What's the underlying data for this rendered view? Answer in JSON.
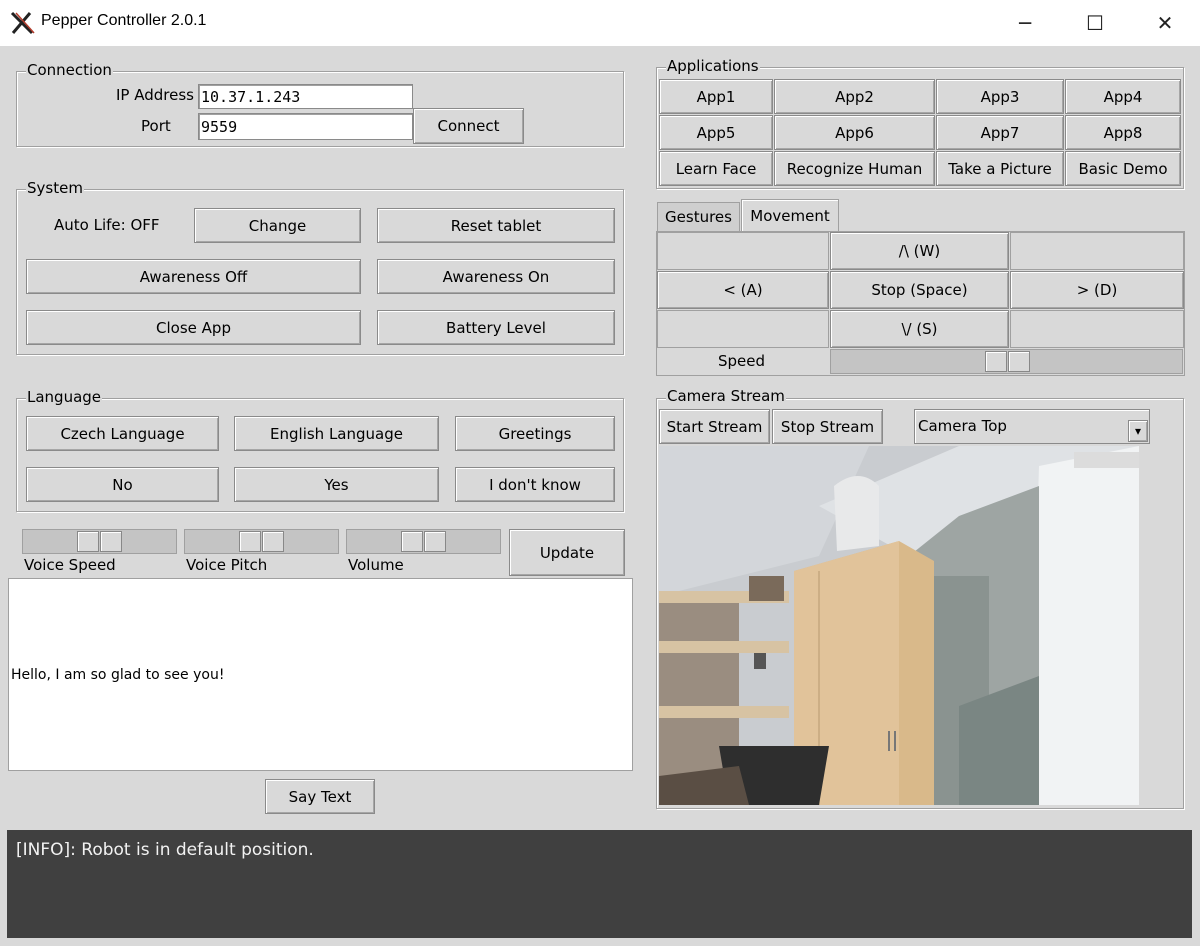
{
  "window": {
    "title": "Pepper Controller 2.0.1",
    "minimize": "─",
    "maximize": "☐",
    "close": "✕"
  },
  "connection": {
    "legend": "Connection",
    "ip_label": "IP Address",
    "ip_value": "10.37.1.243",
    "port_label": "Port",
    "port_value": "9559",
    "connect": "Connect"
  },
  "system": {
    "legend": "System",
    "auto_life": "Auto Life: OFF",
    "change": "Change",
    "reset_tablet": "Reset tablet",
    "awareness_off": "Awareness Off",
    "awareness_on": "Awareness On",
    "close_app": "Close App",
    "battery_level": "Battery Level"
  },
  "language": {
    "legend": "Language",
    "czech": "Czech Language",
    "english": "English Language",
    "greetings": "Greetings",
    "no": "No",
    "yes": "Yes",
    "dont_know": "I don't know"
  },
  "voice": {
    "speed_label": "Voice Speed",
    "pitch_label": "Voice Pitch",
    "volume_label": "Volume",
    "update": "Update",
    "speed_level": 0.5,
    "pitch_level": 0.5,
    "volume_level": 0.5
  },
  "say": {
    "text": "Hello, I am so glad to see you!",
    "button": "Say Text"
  },
  "applications": {
    "legend": "Applications",
    "buttons": [
      "App1",
      "App2",
      "App3",
      "App4",
      "App5",
      "App6",
      "App7",
      "App8",
      "Learn Face",
      "Recognize Human",
      "Take a Picture",
      "Basic Demo"
    ]
  },
  "tabs": {
    "gestures": "Gestures",
    "movement": "Movement"
  },
  "movement": {
    "up": "/\\ (W)",
    "left": "< (A)",
    "stop": "Stop (Space)",
    "right": "> (D)",
    "down": "\\/ (S)",
    "speed_label": "Speed",
    "speed_level": 0.5
  },
  "camera": {
    "legend": "Camera Stream",
    "start": "Start Stream",
    "stop": "Stop Stream",
    "selected": "Camera Top",
    "dropdown_icon": "▾"
  },
  "log": {
    "text": "[INFO]: Robot is in default position."
  }
}
